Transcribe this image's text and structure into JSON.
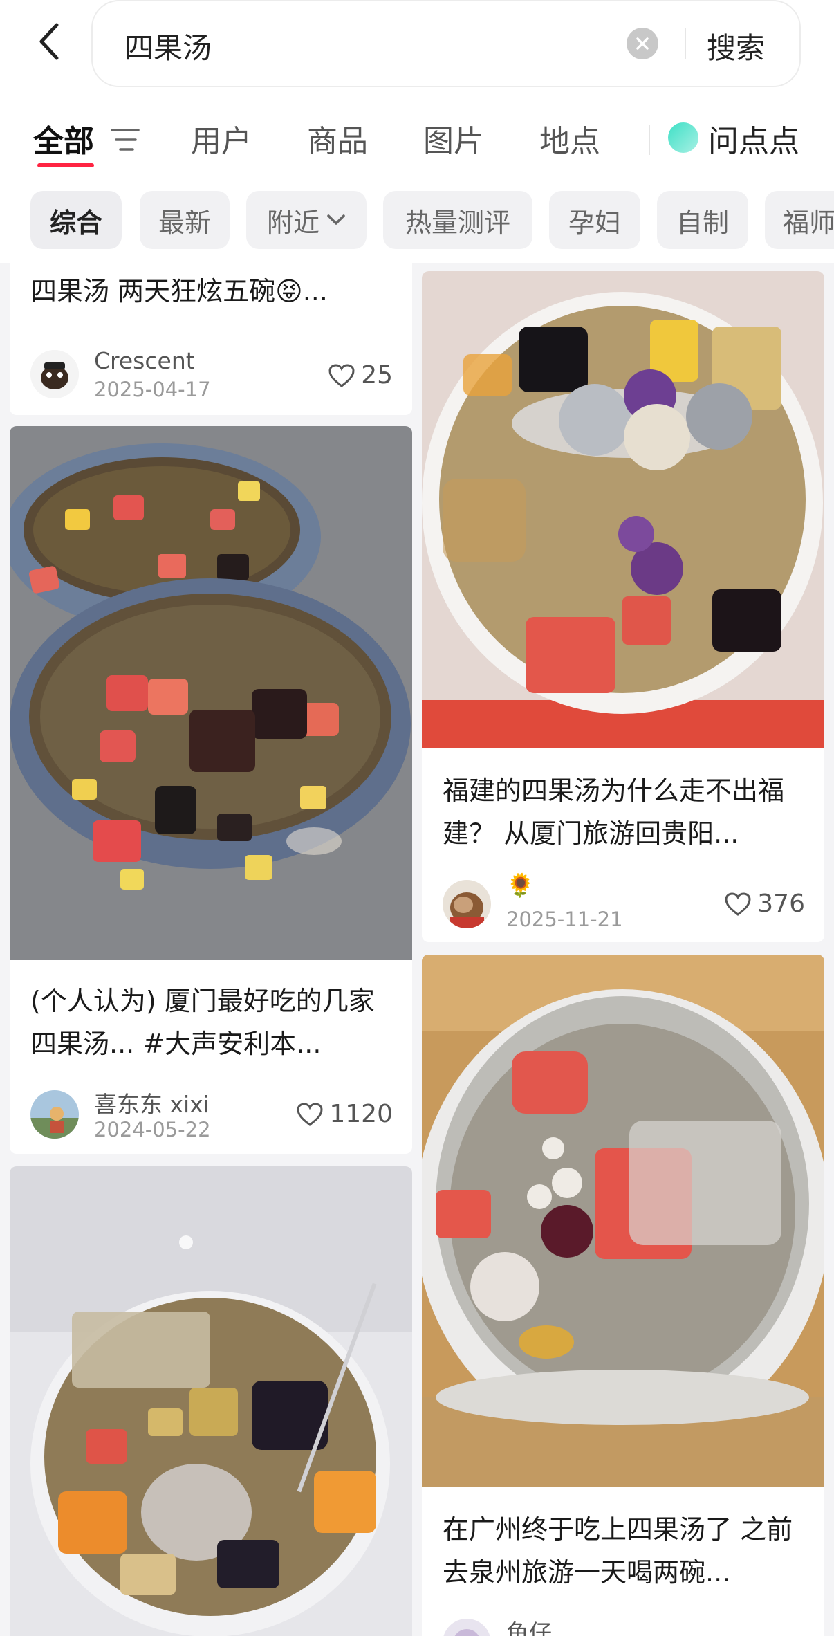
{
  "search": {
    "query": "四果汤",
    "button_label": "搜索"
  },
  "tabs": [
    {
      "label": "全部"
    },
    {
      "label": "用户"
    },
    {
      "label": "商品"
    },
    {
      "label": "图片"
    },
    {
      "label": "地点"
    },
    {
      "label": "问点点"
    }
  ],
  "chips": [
    {
      "label": "综合"
    },
    {
      "label": "最新"
    },
    {
      "label": "附近"
    },
    {
      "label": "热量测评"
    },
    {
      "label": "孕妇"
    },
    {
      "label": "自制"
    },
    {
      "label": "福师"
    }
  ],
  "cards": [
    {
      "title": "四果汤 两天狂炫五碗😝...",
      "author": "Crescent",
      "date": "2025-04-17",
      "likes": "25"
    },
    {
      "title": "(个人认为) 厦门最好吃的几家四果汤... #大声安利本...",
      "author": "喜东东 xixi",
      "date": "2024-05-22",
      "likes": "1120"
    },
    {
      "title": "福建的四果汤为什么走不出福建？ 从厦门旅游回贵阳...",
      "author": "🌻",
      "date": "2025-11-21",
      "likes": "376"
    },
    {
      "title": "在广州终于吃上四果汤了 之前去泉州旅游一天喝两碗...",
      "author": "鱼仔",
      "date": "",
      "likes": ""
    }
  ],
  "colors": {
    "accent": "#ff2442",
    "background": "#f4f4f6"
  },
  "icons": {
    "back": "chevron-left-icon",
    "clear": "clear-icon",
    "filter": "filter-icon",
    "chevron": "chevron-down-icon",
    "like": "heart-icon"
  }
}
